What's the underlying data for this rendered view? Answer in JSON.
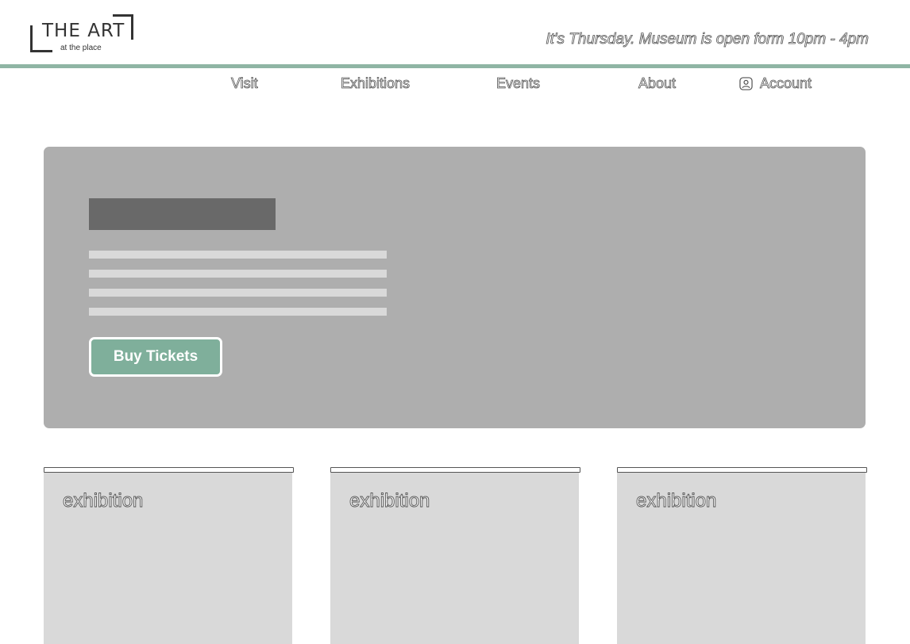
{
  "header": {
    "logo_title": "THE ART",
    "logo_subtitle": "at the place",
    "hours_text": "It's Thursday. Museum is open form 10pm - 4pm",
    "accent_color": "#8fb5a4"
  },
  "nav": {
    "items": [
      {
        "label": "Visit"
      },
      {
        "label": "Exhibitions"
      },
      {
        "label": "Events"
      },
      {
        "label": "About"
      }
    ],
    "account": {
      "label": "Account",
      "icon": "account-icon"
    }
  },
  "hero": {
    "button_label": "Buy Tickets",
    "button_color": "#7faf9b",
    "background_color": "#aeaeae"
  },
  "cards": [
    {
      "label": "exhibition"
    },
    {
      "label": "exhibition"
    },
    {
      "label": "exhibition"
    }
  ]
}
